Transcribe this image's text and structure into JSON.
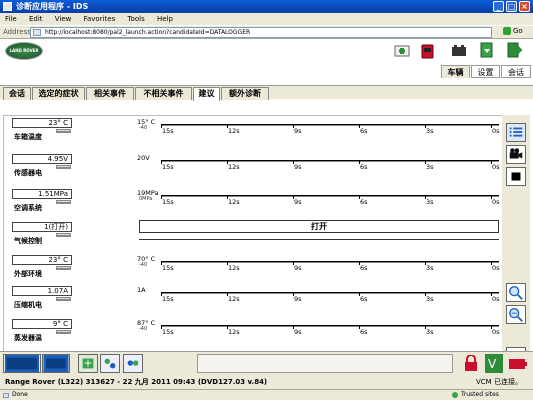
{
  "window": {
    "title": "诊断应用程序 - IDS",
    "minimize": "_",
    "maximize": "□",
    "close": "×"
  },
  "menu": [
    "File",
    "Edit",
    "View",
    "Favorites",
    "Tools",
    "Help"
  ],
  "address": {
    "label": "Address",
    "url": "http://localhost:8080/pal2_launch.action?candidateId=DATALOGGER",
    "go": "Go"
  },
  "brand": {
    "logo": "LAND ROVER"
  },
  "right_tabs": [
    "车辆",
    "设置",
    "会话"
  ],
  "tabs": [
    "会话",
    "选定的症状",
    "相关事件",
    "不相关事件",
    "建议",
    "额外诊断"
  ],
  "active_tab": "建议",
  "time_ticks": [
    "15s",
    "12s",
    "9s",
    "6s",
    "3s",
    "0s"
  ],
  "rows": [
    {
      "value": "23° C",
      "label": "车箱温度",
      "ymax": "15° C",
      "ymin": "-40"
    },
    {
      "value": "4.95V",
      "label": "传感器电",
      "ymax": "20V"
    },
    {
      "value": "1.51MPa",
      "label": "空调系统",
      "ymax": "19MPa",
      "ymin": "0MPa"
    },
    {
      "value": "1(打开)",
      "label": "气候控制",
      "status": "打开"
    },
    {
      "value": "23° C",
      "label": "外部环境",
      "ymax": "70° C",
      "ymin": "-40"
    },
    {
      "value": "1.07A",
      "label": "压缩机电",
      "ymax": "1A"
    },
    {
      "value": "9° C",
      "label": "蒸发器温",
      "ymax": "87° C",
      "ymin": "-40"
    }
  ],
  "footer": {
    "vehicle": "Range Rover (L322) 313627 - 22 九月 2011 09:43 (DVD127.03 v.84)",
    "vcm": "VCM 已连接。"
  },
  "statusbar": {
    "left": "Done",
    "right": "Trusted sites"
  },
  "colors": {
    "titlebar": "#0a5fd8",
    "accent_blue": "#1c5fb8",
    "brand_green": "#2e7d3a",
    "lock_red": "#c8102e"
  }
}
